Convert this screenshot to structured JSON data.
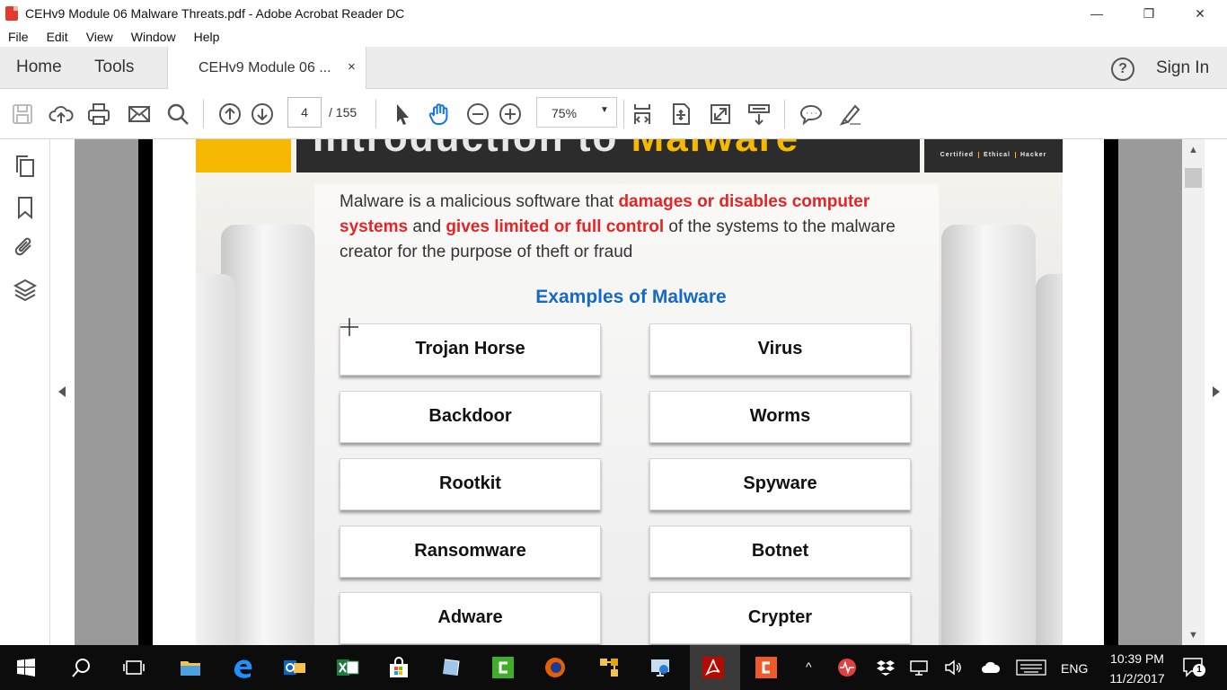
{
  "window": {
    "title": "CEHv9 Module 06 Malware Threats.pdf - Adobe Acrobat Reader DC",
    "minimize": "—",
    "restore": "❐",
    "close": "✕"
  },
  "menu": [
    "File",
    "Edit",
    "View",
    "Window",
    "Help"
  ],
  "tabs": {
    "home": "Home",
    "tools": "Tools",
    "document": "CEHv9 Module 06 ...",
    "document_close": "×",
    "help": "?",
    "sign_in": "Sign In"
  },
  "toolbar": {
    "page_current": "4",
    "page_total": "/ 155",
    "zoom": "75%",
    "zoom_caret": "▼"
  },
  "document": {
    "banner_ghost": "Introduction to",
    "banner_ghost_highlight": "Malware",
    "logo_words": [
      "Certified",
      "Ethical",
      "Hacker"
    ],
    "intro": {
      "p1": "Malware is a malicious software that ",
      "r1": "damages or disables computer systems",
      "p2": " and ",
      "r2": "gives limited or full control",
      "p3": " of the systems to the malware creator for the purpose of theft or fraud"
    },
    "examples_title": "Examples of Malware",
    "examples": [
      "Trojan Horse",
      "Virus",
      "Backdoor",
      "Worms",
      "Rootkit",
      "Spyware",
      "Ransomware",
      "Botnet",
      "Adware",
      "Crypter"
    ]
  },
  "scroll": {
    "up": "▲",
    "down": "▼"
  },
  "taskbar": {
    "language": "ENG",
    "time": "10:39 PM",
    "date": "11/2/2017",
    "notifications": "1"
  },
  "colors": {
    "accent_red": "#e42426",
    "title_blue": "#1569c7",
    "banner_yellow": "#f6b800",
    "taskbar": "#0c0c0c"
  }
}
